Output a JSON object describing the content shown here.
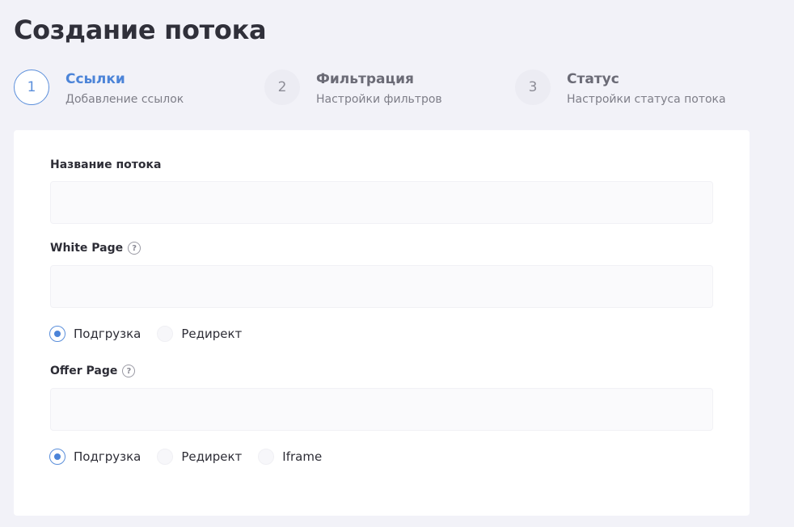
{
  "page": {
    "title": "Создание потока"
  },
  "steps": [
    {
      "number": "1",
      "label": "Ссылки",
      "desc": "Добавление ссылок",
      "active": true
    },
    {
      "number": "2",
      "label": "Фильтрация",
      "desc": "Настройки фильтров",
      "active": false
    },
    {
      "number": "3",
      "label": "Статус",
      "desc": "Настройки статуса потока",
      "active": false
    }
  ],
  "form": {
    "stream_name": {
      "label": "Название потока",
      "value": "",
      "placeholder": ""
    },
    "white_page": {
      "label": "White Page",
      "help_icon": "question-circle-icon",
      "value": "",
      "placeholder": "",
      "options": [
        "Подгрузка",
        "Редирект"
      ],
      "selected": "Подгрузка"
    },
    "offer_page": {
      "label": "Offer Page",
      "help_icon": "question-circle-icon",
      "value": "",
      "placeholder": "",
      "options": [
        "Подгрузка",
        "Редирект",
        "Iframe"
      ],
      "selected": "Подгрузка"
    }
  },
  "colors": {
    "accent": "#4c84d8",
    "background": "#f2f2f8",
    "card": "#ffffff"
  }
}
